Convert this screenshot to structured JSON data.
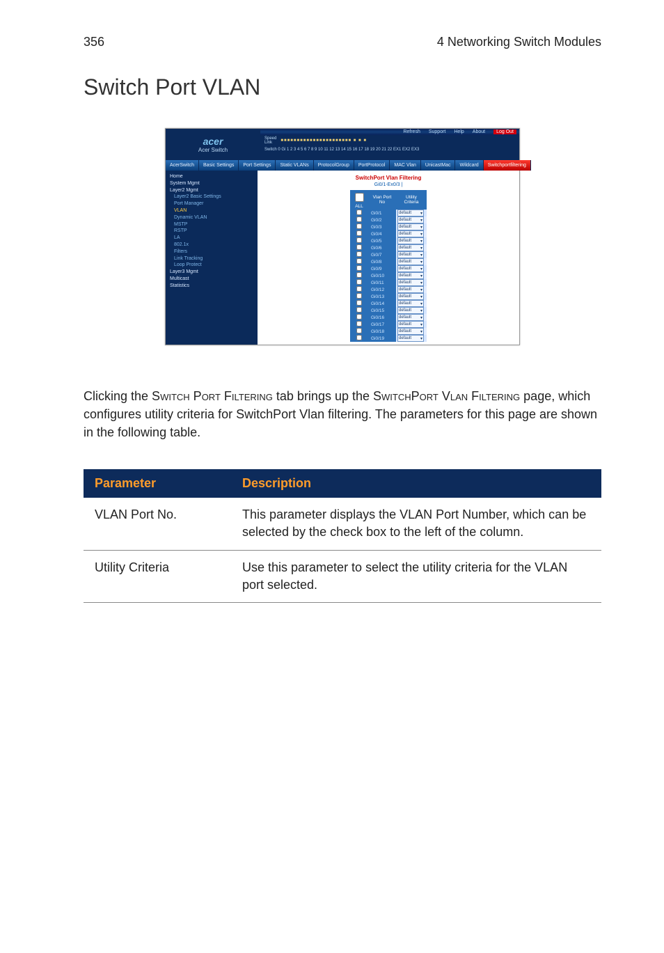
{
  "header": {
    "page_no": "356",
    "chapter": "4 Networking Switch Modules"
  },
  "title": "Switch Port VLAN",
  "screenshot": {
    "brand": "acer",
    "product": "Acer Switch",
    "top_links": [
      "Refresh",
      "Support",
      "Help",
      "About",
      "Log Out"
    ],
    "port_labels": {
      "speed": "Speed",
      "link": "Link",
      "switch": "Switch 0 Gi 1 2 3 4 5 6 7 8 9 10 11 12 13 14 15 16 17 18 19 20 21 22 EX1 EX2 EX3"
    },
    "tabs": {
      "side": "AcerSwitch",
      "items": [
        "Basic Settings",
        "Port Settings",
        "Static VLANs",
        "ProtocolGroup",
        "PortProtocol",
        "MAC Vlan",
        "UnicastMac",
        "Wildcard",
        "Switchportfiltering"
      ],
      "active_index": 8
    },
    "nav": [
      {
        "cls": "h",
        "t": "Home"
      },
      {
        "cls": "h",
        "t": "System Mgmt"
      },
      {
        "cls": "h",
        "t": "Layer2 Mgmt"
      },
      {
        "cls": "s1",
        "t": "Layer2 Basic Settings"
      },
      {
        "cls": "s1",
        "t": "Port Manager"
      },
      {
        "cls": "s1 sel",
        "t": "VLAN"
      },
      {
        "cls": "s1",
        "t": "Dynamic VLAN"
      },
      {
        "cls": "s1",
        "t": "MSTP"
      },
      {
        "cls": "s1",
        "t": "RSTP"
      },
      {
        "cls": "s1",
        "t": "LA"
      },
      {
        "cls": "s1",
        "t": "802.1x"
      },
      {
        "cls": "s1",
        "t": "Filters"
      },
      {
        "cls": "s1",
        "t": "Link Tracking"
      },
      {
        "cls": "s1",
        "t": "Loop Protect"
      },
      {
        "cls": "h",
        "t": "Layer3 Mgmt"
      },
      {
        "cls": "h",
        "t": "Multicast"
      },
      {
        "cls": "h",
        "t": "Statistics"
      }
    ],
    "panel_title": "SwitchPort Vlan Filtering",
    "panel_sub": "Gi0/1-Ex0/3 |",
    "table": {
      "hdr_all": "ALL",
      "hdr_port": "Vlan Port No",
      "hdr_util": "Utility Criteria",
      "default": "default",
      "ports": [
        "Gi0/1",
        "Gi0/2",
        "Gi0/3",
        "Gi0/4",
        "Gi0/5",
        "Gi0/6",
        "Gi0/7",
        "Gi0/8",
        "Gi0/9",
        "Gi0/10",
        "Gi0/11",
        "Gi0/12",
        "Gi0/13",
        "Gi0/14",
        "Gi0/15",
        "Gi0/16",
        "Gi0/17",
        "Gi0/18",
        "Gi0/19"
      ]
    }
  },
  "body_text": {
    "p1a": "Clicking the S",
    "p1b": "witch",
    "p1c": " P",
    "p1d": "ort",
    "p1e": " F",
    "p1f": "iltering",
    "p1g": " tab brings up the S",
    "p1h": "witch",
    "p1i": "P",
    "p1j": "ort",
    "p1k": " V",
    "p1l": "lan",
    "p1m": " F",
    "p1n": "iltering",
    "p1o": " page, which configures utility criteria for SwitchPort Vlan filtering. The parameters for this page are shown in the following table."
  },
  "table": {
    "h1": "Parameter",
    "h2": "Description",
    "rows": [
      {
        "p": "VLAN Port No.",
        "d": "This parameter displays the VLAN Port Number, which can be selected by the check box to the left of the column."
      },
      {
        "p": "Utility Criteria",
        "d": "Use this parameter to select the utility criteria for the VLAN port selected."
      }
    ]
  }
}
